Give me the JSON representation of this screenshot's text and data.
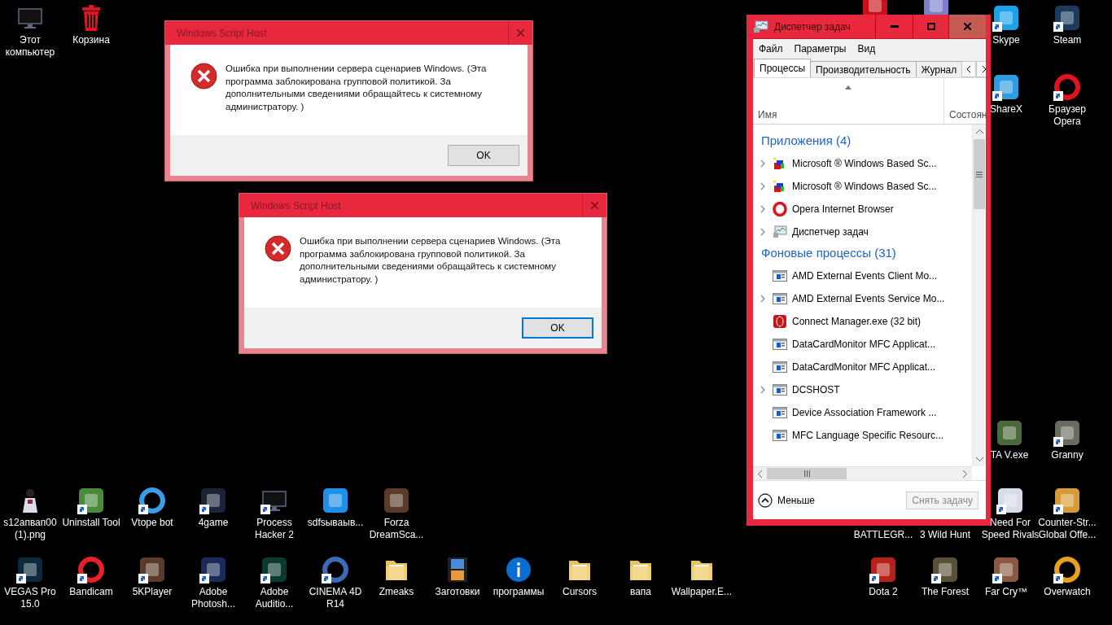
{
  "desktop_icons": [
    {
      "label": "Этот компьютер",
      "kind": "monitor",
      "shortcut": false
    },
    {
      "label": "Корзина",
      "kind": "trash",
      "shortcut": false
    },
    {
      "kind": "app",
      "color": "#c8101a"
    },
    {
      "kind": "app",
      "color": "#7a7fc8"
    },
    {
      "label": "Skype",
      "kind": "app",
      "color": "#1aa3e8",
      "shortcut": true
    },
    {
      "label": "Steam",
      "kind": "app",
      "color": "#1b3a5c",
      "shortcut": true
    },
    {
      "label": "ShareX",
      "kind": "app",
      "color": "#2f9be0",
      "shortcut": true
    },
    {
      "label": "Браузер Opera",
      "kind": "ring",
      "color": "#e0141e",
      "shortcut": true
    },
    {
      "label": "TA V.exe",
      "kind": "app",
      "color": "#4a6a3a",
      "shortcut": false
    },
    {
      "label": "Granny",
      "kind": "app",
      "color": "#6a6a60",
      "shortcut": true
    },
    {
      "label": "s12апвап00 (1).png",
      "kind": "figure",
      "shortcut": false
    },
    {
      "label": "Uninstall Tool",
      "kind": "app",
      "color": "#4a8a3a",
      "shortcut": true
    },
    {
      "label": "Vtope bot",
      "kind": "ring",
      "color": "#3a9de8",
      "shortcut": true
    },
    {
      "label": "4game",
      "kind": "app",
      "color": "#1c2438",
      "shortcut": true
    },
    {
      "label": "Process Hacker 2",
      "kind": "monitor",
      "shortcut": true
    },
    {
      "label": "sdfsываыв...",
      "kind": "app",
      "color": "#1e90e8",
      "shortcut": false
    },
    {
      "label": "Forza DreamSca...",
      "kind": "app",
      "color": "#5a3a28",
      "shortcut": false
    },
    {
      "label": "BATTLEGR...",
      "kind": "covered"
    },
    {
      "label": "3 Wild Hunt",
      "kind": "covered"
    },
    {
      "label": "Need For Speed Rivals",
      "kind": "app",
      "color": "#d8dce8",
      "shortcut": true
    },
    {
      "label": "Counter-Str... Global Offe...",
      "kind": "app",
      "color": "#d89a38",
      "shortcut": true
    },
    {
      "label": "VEGAS Pro 15.0",
      "kind": "app",
      "color": "#0d2a3a",
      "shortcut": true
    },
    {
      "label": "Bandicam",
      "kind": "ring",
      "color": "#e8202a",
      "shortcut": true
    },
    {
      "label": "5KPlayer",
      "kind": "app",
      "color": "#5a3a28",
      "shortcut": true
    },
    {
      "label": "Adobe Photosh...",
      "kind": "app",
      "color": "#1a2a5a",
      "shortcut": true
    },
    {
      "label": "Adobe Auditio...",
      "kind": "app",
      "color": "#0a3a30",
      "shortcut": true
    },
    {
      "label": "CINEMA 4D R14",
      "kind": "ring",
      "color": "#3a6ab8",
      "shortcut": true
    },
    {
      "label": "Zmeaks",
      "kind": "folder",
      "shortcut": false
    },
    {
      "label": "Заготовки",
      "kind": "film",
      "shortcut": false
    },
    {
      "label": "программы",
      "kind": "info",
      "shortcut": false
    },
    {
      "label": "Cursors",
      "kind": "folder",
      "shortcut": false
    },
    {
      "label": "вапа",
      "kind": "folder",
      "shortcut": false
    },
    {
      "label": "Wallpaper.E...",
      "kind": "folder",
      "shortcut": false
    },
    {
      "label": "Dota 2",
      "kind": "app",
      "color": "#b8201a",
      "shortcut": true
    },
    {
      "label": "The Forest",
      "kind": "app",
      "color": "#5a5038",
      "shortcut": true
    },
    {
      "label": "Far Cry™",
      "kind": "app",
      "color": "#8a5a40",
      "shortcut": true
    },
    {
      "label": "Overwatch",
      "kind": "ring",
      "color": "#e8a020",
      "shortcut": true
    }
  ],
  "dialogs": [
    {
      "title": "Windows Script Host",
      "message": "Ошибка при выполнении сервера сценариев Windows. (Эта программа заблокирована групповой политикой. За дополнительными сведениями обращайтесь к системному администратору. )",
      "button": {
        "label": "OK",
        "focused": false
      }
    },
    {
      "title": "Windows Script Host",
      "message": "Ошибка при выполнении сервера сценариев Windows. (Эта программа заблокирована групповой политикой. За дополнительными сведениями обращайтесь к системному администратору. )",
      "button": {
        "label": "OK",
        "focused": true
      }
    }
  ],
  "task_manager": {
    "title": "Диспетчер задач",
    "menu": [
      "Файл",
      "Параметры",
      "Вид"
    ],
    "tabs": [
      {
        "label": "Процессы",
        "selected": true
      },
      {
        "label": "Производительность",
        "selected": false
      },
      {
        "label": "Журнал",
        "selected": false
      }
    ],
    "columns": [
      "Имя",
      "Состоян"
    ],
    "groups": [
      {
        "title": "Приложения (4)",
        "rows": [
          {
            "name": "Microsoft ® Windows Based Sc...",
            "kind": "script",
            "expandable": true
          },
          {
            "name": "Microsoft ® Windows Based Sc...",
            "kind": "script",
            "expandable": true
          },
          {
            "name": "Opera Internet Browser",
            "kind": "opera",
            "expandable": true
          },
          {
            "name": "Диспетчер задач",
            "kind": "taskmgr",
            "expandable": true
          }
        ]
      },
      {
        "title": "Фоновые процессы (31)",
        "rows": [
          {
            "name": "AMD External Events Client Mo...",
            "kind": "window",
            "expandable": false
          },
          {
            "name": "AMD External Events Service Mo...",
            "kind": "window",
            "expandable": true
          },
          {
            "name": "Connect Manager.exe (32 bit)",
            "kind": "redapp",
            "expandable": false
          },
          {
            "name": "DataCardMonitor MFC Applicat...",
            "kind": "window",
            "expandable": false
          },
          {
            "name": "DataCardMonitor MFC Applicat...",
            "kind": "window",
            "expandable": false
          },
          {
            "name": "DCSHOST",
            "kind": "window",
            "expandable": true
          },
          {
            "name": "Device Association Framework ...",
            "kind": "window",
            "expandable": false
          },
          {
            "name": "MFC Language Specific Resourc...",
            "kind": "window",
            "expandable": false
          }
        ]
      }
    ],
    "fewer": "Меньше",
    "end_task": {
      "label": "Снять задачу",
      "disabled": true
    }
  }
}
